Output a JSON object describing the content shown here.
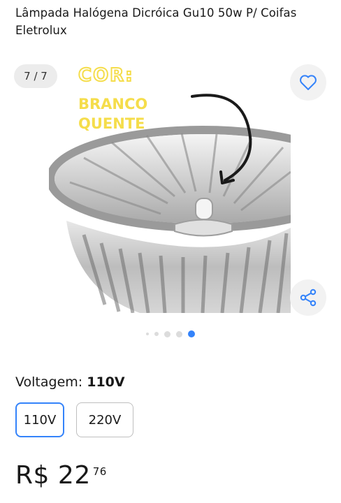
{
  "product": {
    "title": "Lâmpada Halógena Dicróica Gu10 50w P/ Coifas Eletrolux"
  },
  "gallery": {
    "counter": "7 / 7",
    "total": 5,
    "active_index": 4,
    "image": {
      "caption_line1": "COR:",
      "caption_line2": "BRANCO",
      "caption_line3": "QUENTE"
    }
  },
  "icons": {
    "favorite": "heart-icon",
    "share": "share-icon"
  },
  "variant": {
    "label": "Voltagem:",
    "selected_value": "110V",
    "options": [
      "110V",
      "220V"
    ]
  },
  "price": {
    "currency": "R$",
    "integer": "22",
    "cents": "76"
  },
  "colors": {
    "accent": "#3483fa",
    "caption_yellow": "#f5dd4b"
  }
}
